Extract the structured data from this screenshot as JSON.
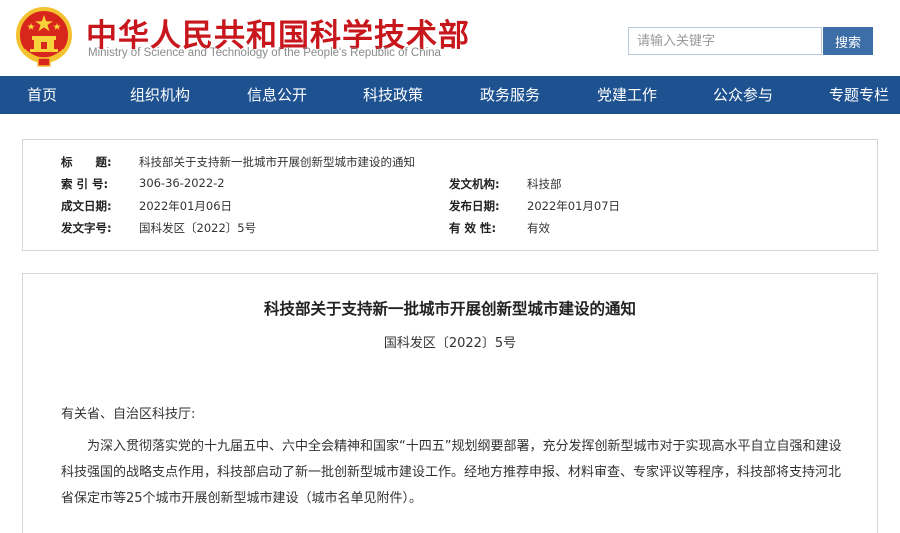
{
  "header": {
    "title": "中华人民共和国科学技术部",
    "subtitle": "Ministry of Science and Technology of the People's Republic of China",
    "search_placeholder": "请输入关键字",
    "search_button": "搜索",
    "colors": {
      "title_red": "#c8161d",
      "nav_blue": "#1d5190",
      "button_blue": "#3d6ea8"
    }
  },
  "nav": {
    "items": [
      "首页",
      "组织机构",
      "信息公开",
      "科技政策",
      "政务服务",
      "党建工作",
      "公众参与",
      "专题专栏"
    ]
  },
  "info": {
    "title_label": "标　　题:",
    "title_value": "科技部关于支持新一批城市开展创新型城市建设的通知",
    "index_label": "索 引 号:",
    "index_value": "306-36-2022-2",
    "issuer_label": "发文机构:",
    "issuer_value": "科技部",
    "created_label": "成文日期:",
    "created_value": "2022年01月06日",
    "published_label": "发布日期:",
    "published_value": "2022年01月07日",
    "docno_label": "发文字号:",
    "docno_value": "国科发区〔2022〕5号",
    "validity_label": "有 效 性:",
    "validity_value": "有效"
  },
  "article": {
    "title": "科技部关于支持新一批城市开展创新型城市建设的通知",
    "doc_number": "国科发区〔2022〕5号",
    "salutation": "有关省、自治区科技厅:",
    "paragraph1": "为深入贯彻落实党的十九届五中、六中全会精神和国家“十四五”规划纲要部署，充分发挥创新型城市对于实现高水平自立自强和建设科技强国的战略支点作用，科技部启动了新一批创新型城市建设工作。经地方推荐申报、材料审查、专家评议等程序，科技部将支持河北省保定市等25个城市开展创新型城市建设（城市名单见附件）。"
  }
}
